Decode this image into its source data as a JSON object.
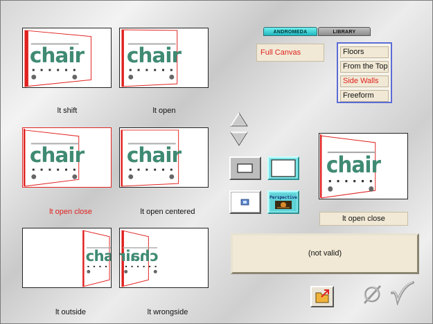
{
  "tabs": {
    "andromeda": "ANDROMEDA",
    "library": "LIBRARY"
  },
  "thumbnails": [
    {
      "label": "lt shift",
      "word": "chair",
      "selected": false
    },
    {
      "label": "lt open",
      "word": "chair",
      "selected": false
    },
    {
      "label": "lt open close",
      "word": "chair",
      "selected": true
    },
    {
      "label": "lt open centered",
      "word": "chair",
      "selected": false
    },
    {
      "label": "lt outside",
      "word": "chair",
      "selected": false
    },
    {
      "label": "lt wrongside",
      "word": "chair",
      "selected": false
    }
  ],
  "canvas_option": "Full Canvas",
  "menu": {
    "items": [
      "Floors",
      "From the Top",
      "Side Walls",
      "Freeform"
    ],
    "selected": "Side Walls"
  },
  "shape_buttons": {
    "perspective_label": "Perspective"
  },
  "preview": {
    "label": "lt open close",
    "word": "chair"
  },
  "status": "(not valid)",
  "colors": {
    "accent_red": "#e0211f",
    "teal": "#7fe6e8",
    "panel_beige": "#f1e9d5",
    "chair_green": "#3f8a73",
    "menu_border": "#5a6bd6"
  },
  "icons": [
    "arrow-up-icon",
    "arrow-down-icon",
    "rectangle-icon",
    "rectangle-white-icon",
    "small-image-icon",
    "perspective-icon",
    "export-folder-icon",
    "none-icon",
    "checkmark-icon"
  ]
}
